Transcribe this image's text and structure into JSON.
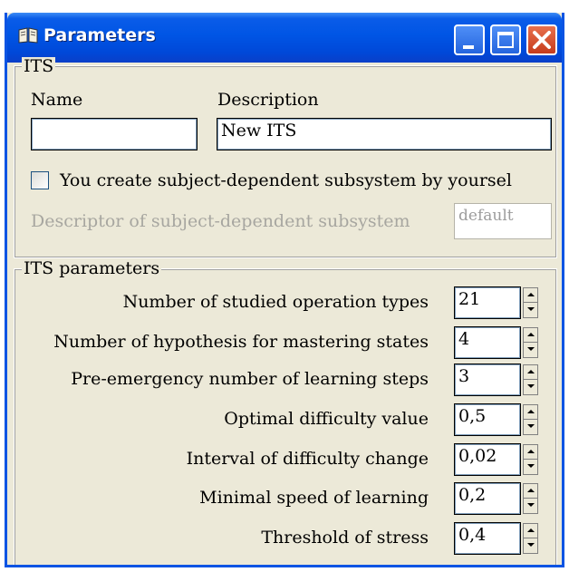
{
  "window": {
    "title": "Parameters"
  },
  "its_group": {
    "legend": "ITS",
    "name_label": "Name",
    "name_value": "",
    "description_label": "Description",
    "description_value": "New ITS",
    "checkbox_label": "You create subject-dependent subsystem by yoursel",
    "checkbox_checked": false,
    "descriptor_label": "Descriptor of subject-dependent subsystem",
    "descriptor_value": "default"
  },
  "params_group": {
    "legend": "ITS parameters",
    "params": [
      {
        "label": "Number of studied operation types",
        "value": "21"
      },
      {
        "label": "Number of hypothesis for mastering states",
        "value": "4"
      },
      {
        "label": "Pre-emergency number of learning steps",
        "value": "3"
      },
      {
        "label": "Optimal difficulty value",
        "value": "0,5"
      },
      {
        "label": "Interval of difficulty change",
        "value": "0,02"
      },
      {
        "label": "Minimal speed of learning",
        "value": "0,2"
      },
      {
        "label": "Threshold of stress",
        "value": "0,4"
      }
    ]
  }
}
